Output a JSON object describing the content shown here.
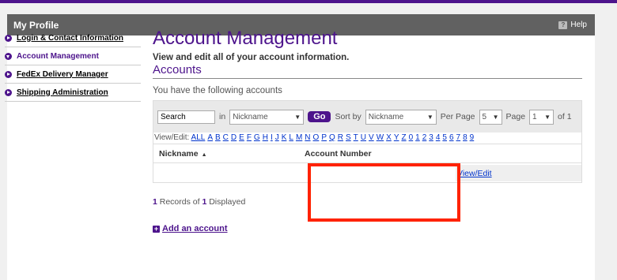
{
  "header": {
    "title": "My Profile",
    "help_label": "Help",
    "help_icon": "?"
  },
  "sidebar": {
    "items": [
      {
        "label": "Login & Contact Information",
        "active": false
      },
      {
        "label": "Account Management",
        "active": true
      },
      {
        "label": "FedEx Delivery Manager",
        "active": false
      },
      {
        "label": "Shipping Administration",
        "active": false
      }
    ]
  },
  "main": {
    "title": "Account Management",
    "subtitle": "View and edit all of your account information.",
    "section_title": "Accounts",
    "intro": "You have the following accounts"
  },
  "filter": {
    "search_value": "Search",
    "in_label": "in",
    "in_select": "Nickname",
    "go_label": "Go",
    "sort_label": "Sort by",
    "sort_select": "Nickname",
    "per_page_label": "Per Page",
    "per_page_value": "5",
    "page_label": "Page",
    "page_value": "1",
    "of_label": "of 1"
  },
  "alpha": {
    "label": "View/Edit:",
    "letters": [
      "ALL",
      "A",
      "B",
      "C",
      "D",
      "E",
      "F",
      "G",
      "H",
      "I",
      "J",
      "K",
      "L",
      "M",
      "N",
      "O",
      "P",
      "Q",
      "R",
      "S",
      "T",
      "U",
      "V",
      "W",
      "X",
      "Y",
      "Z",
      "0",
      "1",
      "2",
      "3",
      "4",
      "5",
      "6",
      "7",
      "8",
      "9"
    ]
  },
  "table": {
    "columns": [
      "Nickname",
      "Account Number"
    ],
    "rows": [
      {
        "nickname": "",
        "account_number": "",
        "action": "View/Edit"
      }
    ]
  },
  "records": {
    "count": "1",
    "mid": " Records of ",
    "displayed": "1",
    "suffix": " Displayed"
  },
  "add_account": "Add an account",
  "colors": {
    "brand": "#4d148c",
    "header": "#616161",
    "highlight": "#ff2200",
    "link": "#0033cc"
  }
}
